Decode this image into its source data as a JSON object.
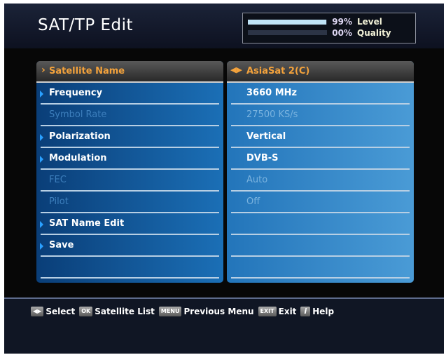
{
  "header": {
    "title": "SAT/TP Edit"
  },
  "signal": {
    "level_value": 0.99,
    "level_pct": "99%",
    "level_label": "Level",
    "quality_value": 0.0,
    "quality_pct": "00%",
    "quality_label": "Quality"
  },
  "fields": [
    {
      "label": "Satellite Name",
      "value": "AsiaSat 2(C)",
      "state": "selected"
    },
    {
      "label": "Frequency",
      "value": "3660 MHz",
      "state": "enabled"
    },
    {
      "label": "Symbol Rate",
      "value": "27500 KS/s",
      "state": "disabled"
    },
    {
      "label": "Polarization",
      "value": "Vertical",
      "state": "enabled"
    },
    {
      "label": "Modulation",
      "value": "DVB-S",
      "state": "enabled"
    },
    {
      "label": "FEC",
      "value": "Auto",
      "state": "disabled"
    },
    {
      "label": "Pilot",
      "value": "Off",
      "state": "disabled"
    },
    {
      "label": "SAT Name Edit",
      "value": "",
      "state": "enabled"
    },
    {
      "label": "Save",
      "value": "",
      "state": "enabled"
    },
    {
      "label": "",
      "value": "",
      "state": "empty"
    }
  ],
  "footer": {
    "keys": [
      {
        "key": "◀▶",
        "text": "Select",
        "icon": "left-right-arrows-icon"
      },
      {
        "key": "OK",
        "text": "Satellite List",
        "icon": "ok-key-icon"
      },
      {
        "key": "MENU",
        "text": "Previous Menu",
        "icon": "menu-key-icon"
      },
      {
        "key": "EXIT",
        "text": "Exit",
        "icon": "exit-key-icon"
      },
      {
        "key": "i",
        "text": "Help",
        "icon": "info-key-icon"
      }
    ]
  },
  "colors": {
    "highlight_text": "#f3a23c",
    "panel_left": "#1b6fb6",
    "panel_right": "#4a9bd6",
    "marker": "#2aa0ff"
  }
}
